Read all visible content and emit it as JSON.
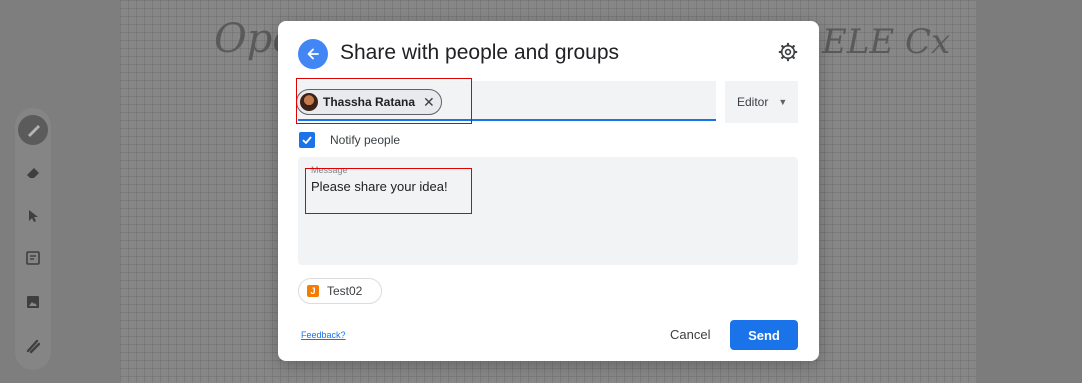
{
  "backdrop": {
    "scribble_left": "Ope",
    "scribble_right": "ELE Cx",
    "tools": [
      "pen-icon",
      "eraser-icon",
      "select-arrow-icon",
      "sticky-note-icon",
      "image-icon",
      "laser-icon"
    ]
  },
  "dialog": {
    "title": "Share with people and groups",
    "recipient": {
      "name": "Thassha Ratana"
    },
    "role": "Editor",
    "notify": {
      "label": "Notify people",
      "checked": true
    },
    "message": {
      "label": "Message",
      "text": "Please share your idea!"
    },
    "tag": {
      "label": "Test02"
    },
    "feedback": "Feedback?",
    "cancel": "Cancel",
    "send": "Send"
  },
  "colors": {
    "accent": "#1a73e8",
    "back_button": "#4285f4",
    "highlight": "#e00000"
  }
}
